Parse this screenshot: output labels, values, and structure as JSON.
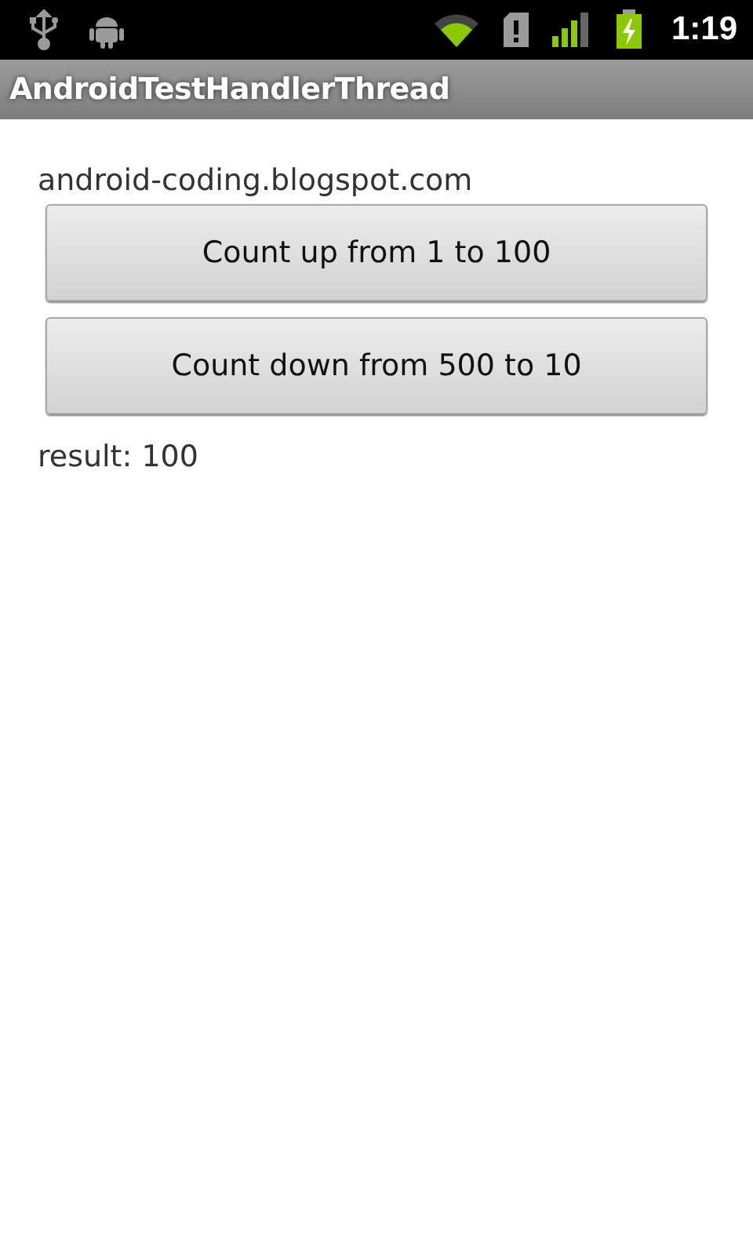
{
  "status_bar": {
    "time": "1:19"
  },
  "title_bar": {
    "title": "AndroidTestHandlerThread"
  },
  "content": {
    "link_text": "android-coding.blogspot.com",
    "buttons": [
      {
        "label": "Count up from 1 to 100"
      },
      {
        "label": "Count down from 500 to 10"
      }
    ],
    "result": "result: 100"
  }
}
